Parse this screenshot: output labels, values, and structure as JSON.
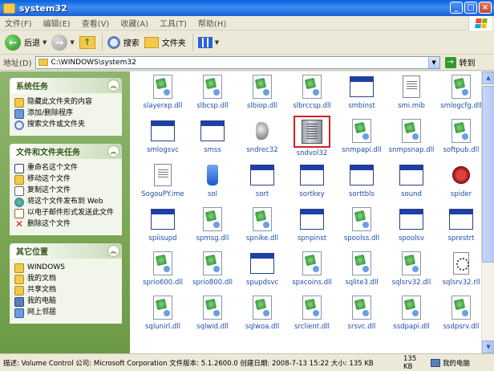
{
  "window": {
    "title": "system32"
  },
  "menu": [
    "文件(F)",
    "编辑(E)",
    "查看(V)",
    "收藏(A)",
    "工具(T)",
    "帮助(H)"
  ],
  "toolbar": {
    "back": "后退",
    "search": "搜索",
    "folders": "文件夹"
  },
  "address": {
    "label": "地址(D)",
    "path": "C:\\WINDOWS\\system32",
    "go": "转到"
  },
  "taskpane": {
    "system": {
      "title": "系统任务",
      "items": [
        "隐藏此文件夹的内容",
        "添加/删除程序",
        "搜索文件或文件夹"
      ]
    },
    "file": {
      "title": "文件和文件夹任务",
      "items": [
        "重命名这个文件",
        "移动这个文件",
        "复制这个文件",
        "将这个文件发布到 Web",
        "以电子邮件形式发送此文件",
        "删除这个文件"
      ]
    },
    "other": {
      "title": "其它位置",
      "items": [
        "WINDOWS",
        "我的文档",
        "共享文档",
        "我的电脑",
        "网上邻居"
      ]
    }
  },
  "files": [
    {
      "name": "slayerxp.dll",
      "icon": "dll"
    },
    {
      "name": "slbcsp.dll",
      "icon": "dll"
    },
    {
      "name": "slbiop.dll",
      "icon": "dll"
    },
    {
      "name": "slbrccsp.dll",
      "icon": "dll"
    },
    {
      "name": "smbinst",
      "icon": "app"
    },
    {
      "name": "smi.mib",
      "icon": "text"
    },
    {
      "name": "smlogcfg.dll",
      "icon": "dll"
    },
    {
      "name": "smlogsvc",
      "icon": "app"
    },
    {
      "name": "smss",
      "icon": "app"
    },
    {
      "name": "sndrec32",
      "icon": "speaker"
    },
    {
      "name": "sndvol32",
      "icon": "volume",
      "selected": true
    },
    {
      "name": "snmpapi.dll",
      "icon": "dll"
    },
    {
      "name": "snmpsnap.dll",
      "icon": "dll"
    },
    {
      "name": "softpub.dll",
      "icon": "dll"
    },
    {
      "name": "SogouPY.ime",
      "icon": "text"
    },
    {
      "name": "sol",
      "icon": "bottle"
    },
    {
      "name": "sort",
      "icon": "app"
    },
    {
      "name": "sortkey",
      "icon": "app"
    },
    {
      "name": "sorttbls",
      "icon": "app"
    },
    {
      "name": "sound",
      "icon": "app"
    },
    {
      "name": "spider",
      "icon": "bug"
    },
    {
      "name": "spiisupd",
      "icon": "app"
    },
    {
      "name": "spmsg.dll",
      "icon": "dll"
    },
    {
      "name": "spnike.dll",
      "icon": "dll"
    },
    {
      "name": "spnpinst",
      "icon": "app"
    },
    {
      "name": "spoolss.dll",
      "icon": "dll"
    },
    {
      "name": "spoolsv",
      "icon": "app"
    },
    {
      "name": "sprestrt",
      "icon": "app"
    },
    {
      "name": "sprio600.dll",
      "icon": "dll"
    },
    {
      "name": "sprio800.dll",
      "icon": "dll"
    },
    {
      "name": "spupdsvc",
      "icon": "app"
    },
    {
      "name": "spxcoins.dll",
      "icon": "dll"
    },
    {
      "name": "sqlite3.dll",
      "icon": "dll"
    },
    {
      "name": "sqlsrv32.dll",
      "icon": "dll"
    },
    {
      "name": "sqlsrv32.rll",
      "icon": "setup"
    },
    {
      "name": "sqlunirl.dll",
      "icon": "dll"
    },
    {
      "name": "sqlwid.dll",
      "icon": "dll"
    },
    {
      "name": "sqlwoa.dll",
      "icon": "dll"
    },
    {
      "name": "srclient.dll",
      "icon": "dll"
    },
    {
      "name": "srsvc.dll",
      "icon": "dll"
    },
    {
      "name": "ssdpapi.dll",
      "icon": "dll"
    },
    {
      "name": "ssdpsrv.dll",
      "icon": "dll"
    }
  ],
  "status": {
    "description": "描述: Volume Control 公司: Microsoft Corporation 文件版本: 5.1.2600.0 创建日期: 2008-7-13 15:22 大小: 135 KB",
    "size": "135 KB",
    "location": "我的电脑"
  },
  "colors": {
    "titlebar": "#0a5fe0",
    "taskpane": "#7aa64f",
    "link": "#1e4ea8"
  }
}
